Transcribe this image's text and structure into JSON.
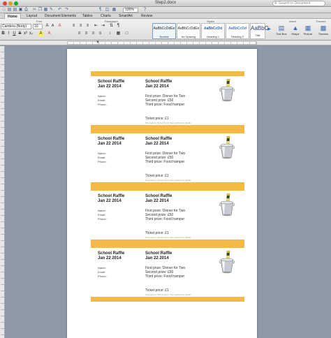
{
  "window": {
    "title": "Step2.docx",
    "search_placeholder": "Search in Document"
  },
  "toolbar": {
    "zoom": "126%"
  },
  "ribbon_tabs": [
    "Home",
    "Layout",
    "Document Elements",
    "Tables",
    "Charts",
    "SmartArt",
    "Review"
  ],
  "ribbon": {
    "font_group": "Font",
    "paragraph_group": "Paragraph",
    "styles_group": "Styles",
    "insert_group": "Insert",
    "themes_group": "Themes",
    "font_name": "Cambria (Body)",
    "font_size": "10",
    "styles": [
      {
        "sample": "AaBbCcDdEe",
        "name": "Normal"
      },
      {
        "sample": "AaBbCcDdEe",
        "name": "No Spacing"
      },
      {
        "sample": "AaBbCcDd",
        "name": "Heading 1"
      },
      {
        "sample": "AaBbCcDd",
        "name": "Heading 2"
      },
      {
        "sample": "AaBbC",
        "name": "Title"
      }
    ],
    "insert_buttons": [
      "Text Box",
      "Shape",
      "Picture"
    ],
    "themes_button": "Themes"
  },
  "tickets": [
    {
      "title": "School Raffle",
      "date": "Jan 22 2014",
      "name_label": "Name:",
      "email_label": "Email:",
      "phone_label": "Phone:",
      "prize1": "First prize: Dinner for Two",
      "prize2": "Second prize: £50",
      "prize3": "Third prize: Food hamper",
      "price": "Ticket price: £1",
      "fine_print": "Proceeds to School Fund. See website for details"
    },
    {
      "title": "School Raffle",
      "date": "Jan 22 2014",
      "name_label": "Name:",
      "email_label": "Email:",
      "phone_label": "Phone:",
      "prize1": "First prize: Dinner for Two",
      "prize2": "Second prize: £50",
      "prize3": "Third prize: Food hamper",
      "price": "Ticket price: £1",
      "fine_print": "Proceeds to School Fund. See website for details"
    },
    {
      "title": "School Raffle",
      "date": "Jan 22 2014",
      "name_label": "Name:",
      "email_label": "Email:",
      "phone_label": "Phone:",
      "prize1": "First prize: Dinner for Two",
      "prize2": "Second prize: £50",
      "prize3": "Third prize: Food hamper",
      "price": "Ticket price: £1",
      "fine_print": "Proceeds to School Fund. See website for details"
    },
    {
      "title": "School Raffle",
      "date": "Jan 22 2014",
      "name_label": "Name:",
      "email_label": "Email:",
      "phone_label": "Phone:",
      "prize1": "First prize: Dinner for Two",
      "prize2": "Second prize: £50",
      "prize3": "Third prize: Food hamper",
      "price": "Ticket price: £1",
      "fine_print": "Proceeds to School Fund. See website for details"
    }
  ],
  "colors": {
    "accent_bar": "#f5b948"
  }
}
